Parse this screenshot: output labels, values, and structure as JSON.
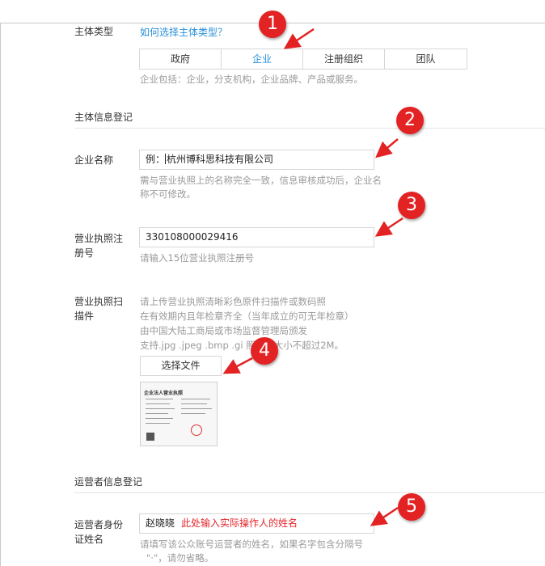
{
  "entity_type": {
    "label": "主体类型",
    "help_link": "如何选择主体类型？",
    "tabs": [
      {
        "label": "政府",
        "active": false
      },
      {
        "label": "企业",
        "active": true
      },
      {
        "label": "注册组织",
        "active": false
      },
      {
        "label": "团队",
        "active": false
      }
    ],
    "hint": "企业包括：企业，分支机构，企业品牌、产品或服务。"
  },
  "entity_info": {
    "section_title": "主体信息登记",
    "company_name": {
      "label": "企业名称",
      "prefix": "例：",
      "value": "杭州博科思科技有限公司",
      "hint_line1": "需与营业执照上的名称完全一致，信息审核成功后，企业名",
      "hint_line2": "称不可修改。"
    },
    "license_number": {
      "label_line1": "营业执照注",
      "label_line2": "册号",
      "value": "330108000029416",
      "hint": "请输入15位营业执照注册号"
    },
    "license_scan": {
      "label_line1": "营业执照扫",
      "label_line2": "描件",
      "hint_lines": [
        "请上传营业执照清晰彩色原件扫描件或数码照",
        "在有效期内且年检章齐全（当年成立的可无年检章）",
        "由中国大陆工商局或市场监督管理局颁发",
        "支持.jpg .jpeg .bmp .gi   照片，大小不超过2M。"
      ],
      "button_label": "选择文件",
      "thumbnail_title": "企业法人营业执照"
    }
  },
  "operator_info": {
    "section_title": "运营者信息登记",
    "id_name": {
      "label_line1": "运营者身份",
      "label_line2": "证姓名",
      "value": "赵晓晓",
      "annotation": "此处输入实际操作人的姓名",
      "hint_line1": "请填写该公众账号运营者的姓名，如果名字包含分隔号",
      "hint_line2": "\"·\"，请勿省略。"
    }
  },
  "badges": [
    "1",
    "2",
    "3",
    "4",
    "5"
  ],
  "colors": {
    "accent": "#2a8fd8",
    "badge": "#e32224",
    "annotation": "#e5252b"
  }
}
